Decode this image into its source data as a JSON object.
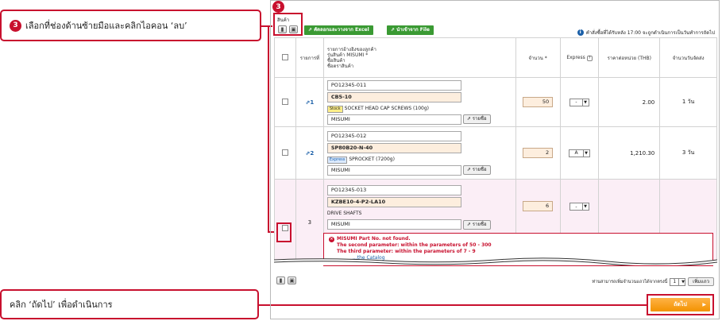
{
  "callouts": {
    "step1_badge": "3",
    "step1_text": "เลือกที่ช่องด้านซ้ายมือและคลิกไอคอน ‘ลบ’",
    "step2_text": "คลิก ‘ถัดไป’ เพื่อดำเนินการ"
  },
  "header": {
    "product_label": "สินค้า",
    "copy_excel": "คัดลอกและวางจาก Excel",
    "import_file": "นำเข้าจาก File",
    "note": "คำสั่งซื้อที่ได้รับหลัง 17:00 จะถูกดำเนินการเป็นวันทำการถัดไป"
  },
  "columns": {
    "item": "รายการที่",
    "desc1": "รายการอ้างอิงของลูกค้า",
    "desc2": "รุ่นสินค้า MISUMI *",
    "desc3": "ชื่อสินค้า",
    "desc4": "ชื่อตราสินค้า",
    "qty": "จำนวน *",
    "express": "Express",
    "unit_price": "ราคาต่อหน่วย (THB)",
    "lead": "จำนวนวันจัดส่ง"
  },
  "rows": [
    {
      "num": "1",
      "ref": "PO12345-011",
      "part": "CB5-10",
      "tag": "Stock",
      "name": "SOCKET HEAD CAP SCREWS (100g)",
      "brand": "MISUMI",
      "detail": "รายชื่อ",
      "qty": "50",
      "express": "-",
      "price": "2.00",
      "lead": "1 วัน"
    },
    {
      "num": "2",
      "ref": "PO12345-012",
      "part": "SP80B20-N-40",
      "tag": "Express",
      "name": "SPROCKET (7200g)",
      "brand": "MISUMI",
      "detail": "รายชื่อ",
      "qty": "2",
      "express": "A",
      "price": "1,210.30",
      "lead": "3 วัน"
    },
    {
      "num": "3",
      "ref": "PO12345-013",
      "part": "KZBE10-4-P2-LA10",
      "tag": "",
      "name": "DRIVE SHAFTS",
      "brand": "MISUMI",
      "detail": "รายชื่อ",
      "qty": "6",
      "express": "-",
      "price": "",
      "lead": ""
    }
  ],
  "error": {
    "title": "MISUMI Part No. not found.",
    "line1": "The second parameter: within the parameters of 50 - 300",
    "line2": "The third parameter: within the parameters of 7 - 9",
    "line3": "...the Catalog"
  },
  "footer": {
    "pager_text": "ท่านสามารถเพิ่มจำนวนแถวได้จากตรงนี้",
    "pager_value": "1",
    "more": "เพิ่มแถว",
    "next": "ถัดไป"
  },
  "colors": {
    "accent": "#c8102e",
    "next": "#f39200",
    "green": "#3a9a33"
  }
}
